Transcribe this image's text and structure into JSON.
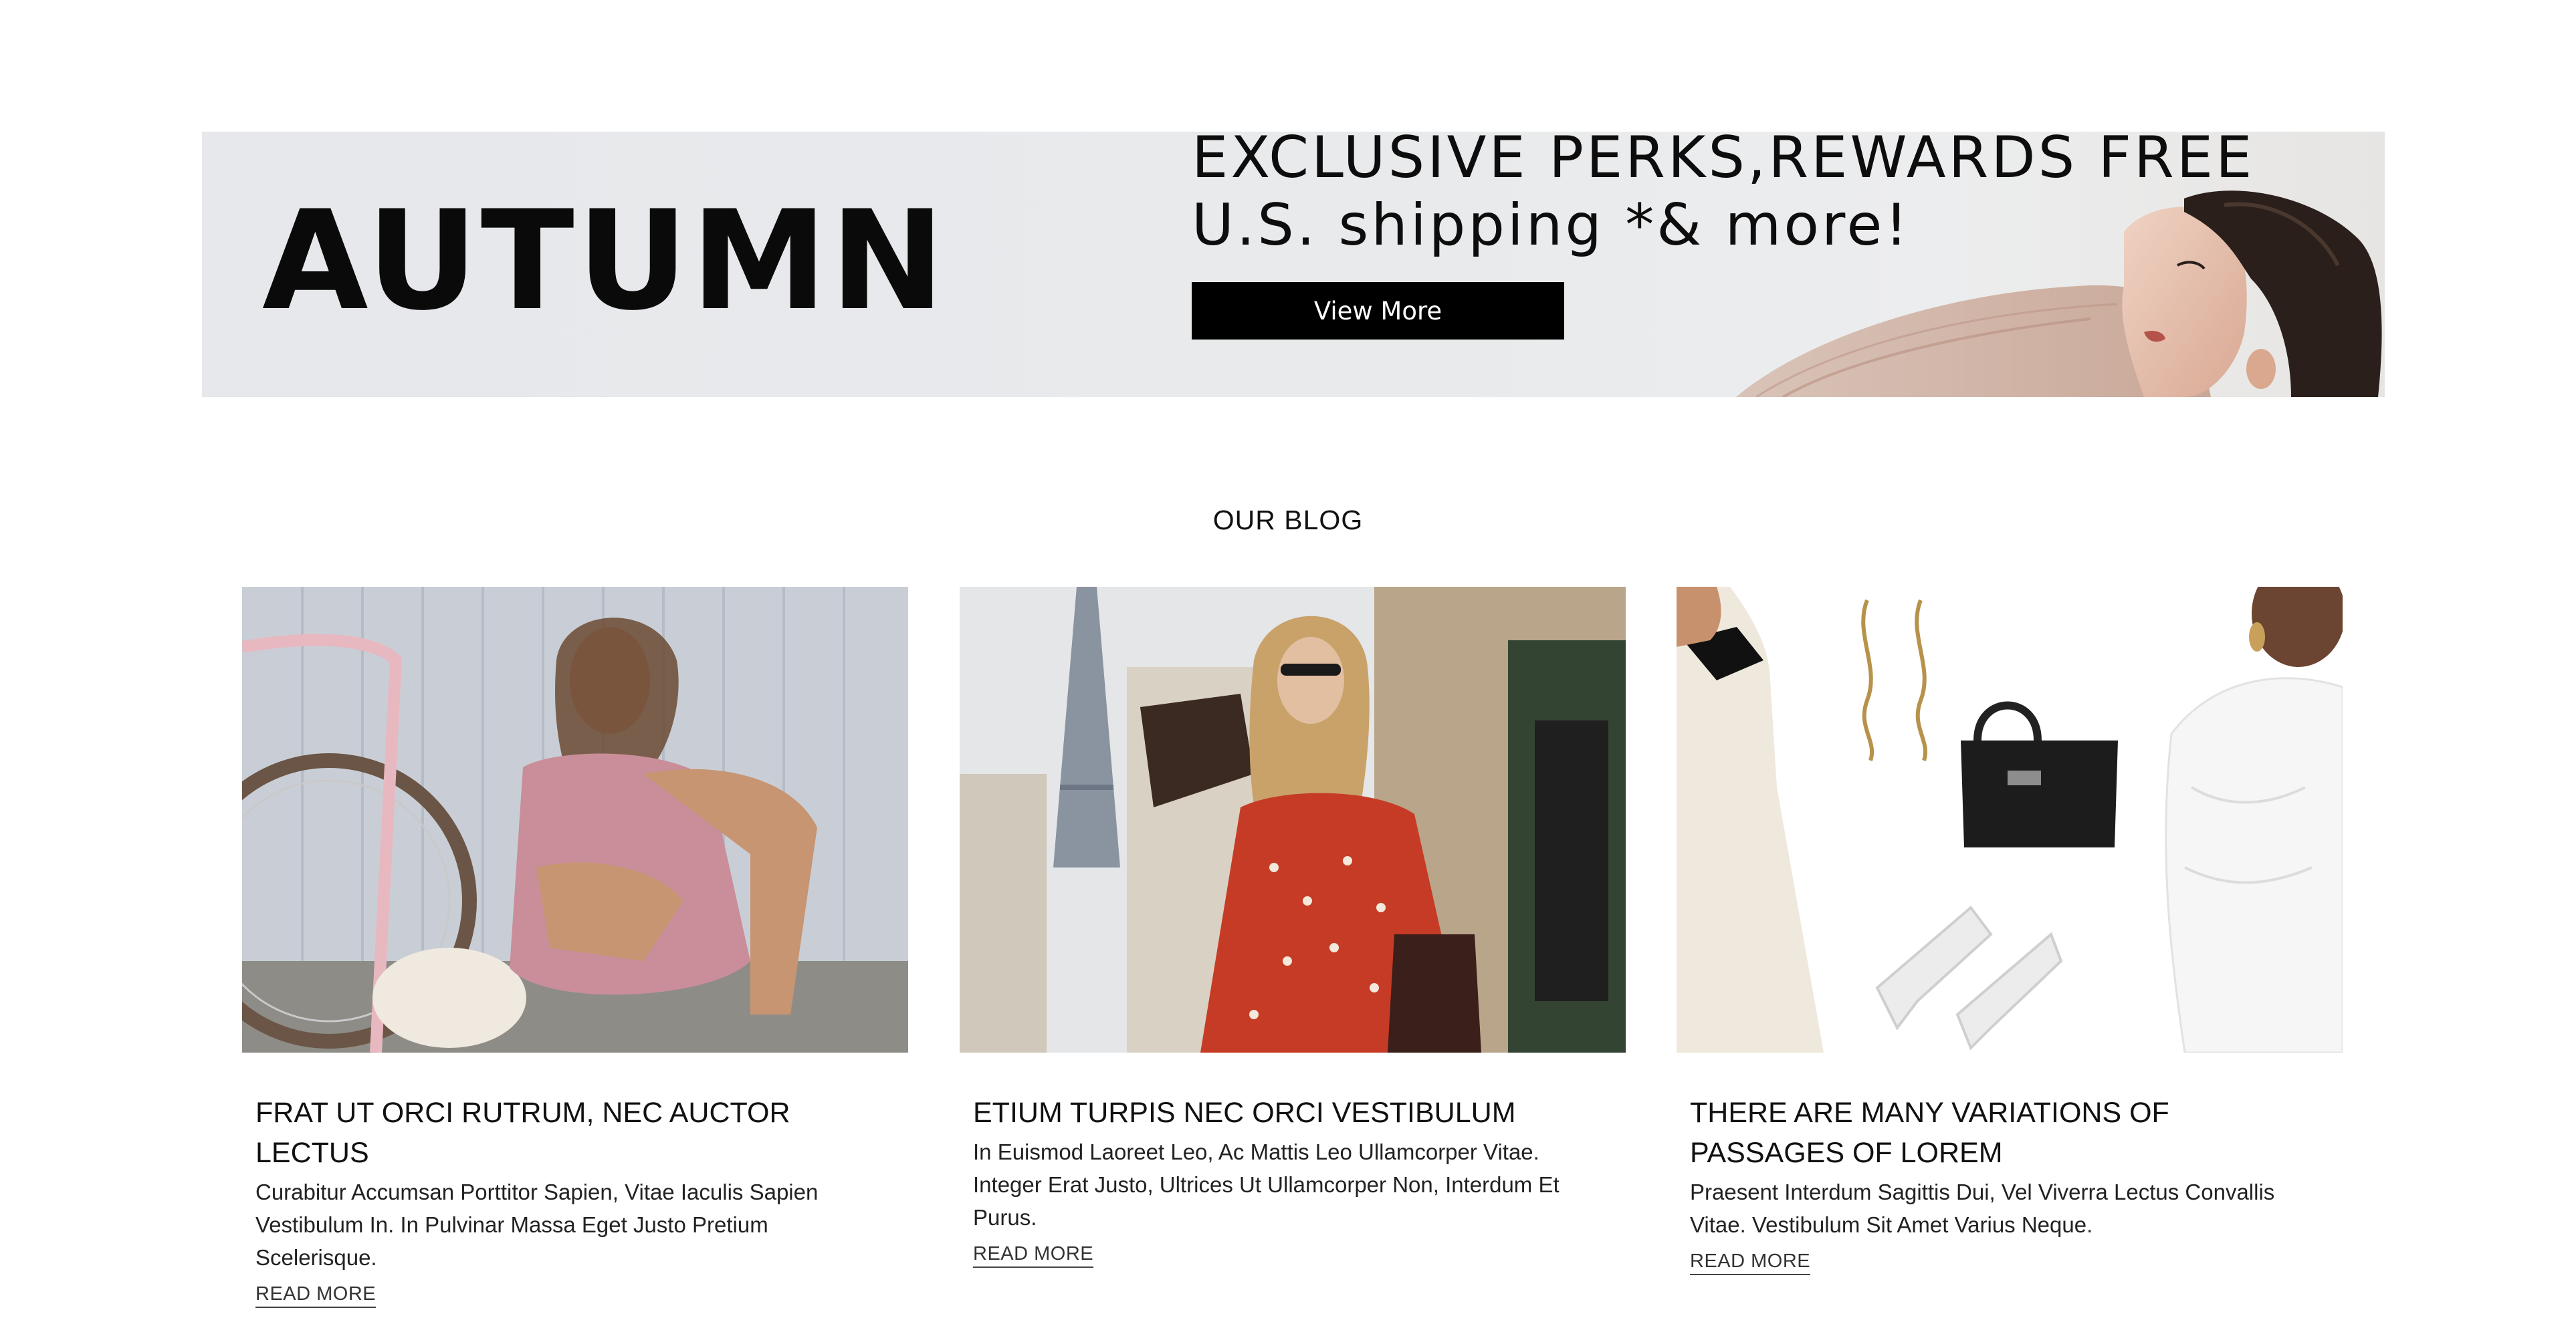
{
  "banner": {
    "title": "AUTUMN",
    "perk_line_1": "EXCLUSIVE PERKS,REWARDS FREE",
    "perk_line_2": "U.S. shipping *& more!",
    "button_label": "View More"
  },
  "blog": {
    "heading": "OUR BLOG",
    "posts": [
      {
        "title": "FRAT UT ORCI RUTRUM, NEC AUCTOR LECTUS",
        "excerpt": "Curabitur Accumsan Porttitor Sapien, Vitae Iaculis Sapien Vestibulum In. In Pulvinar Massa Eget Justo Pretium Scelerisque.",
        "link_label": "READ MORE"
      },
      {
        "title": "ETIUM TURPIS NEC ORCI VESTIBULUM",
        "excerpt": "In Euismod Laoreet Leo, Ac Mattis Leo Ullamcorper Vitae. Integer Erat Justo, Ultrices Ut Ullamcorper Non, Interdum Et Purus.",
        "link_label": "READ MORE"
      },
      {
        "title": "THERE ARE MANY VARIATIONS OF PASSAGES OF LOREM",
        "excerpt": "Praesent Interdum Sagittis Dui, Vel Viverra Lectus Convallis Vitae. Vestibulum Sit Amet Varius Neque.",
        "link_label": "READ MORE"
      }
    ]
  },
  "colors": {
    "banner_bg": "#e6e8eb",
    "button_bg": "#000000",
    "text": "#111111"
  }
}
